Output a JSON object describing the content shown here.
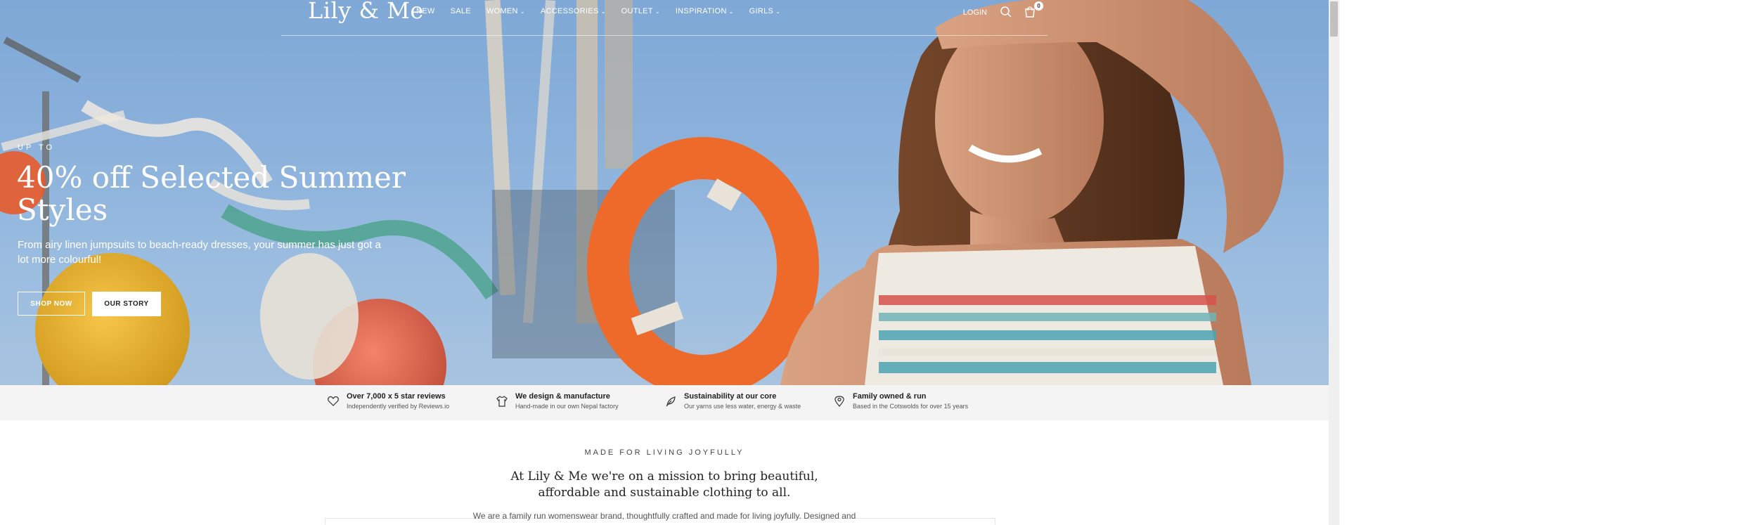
{
  "brand": {
    "logo": "Lily & Me"
  },
  "nav": {
    "items": [
      {
        "label": "NEW",
        "dropdown": false
      },
      {
        "label": "SALE",
        "dropdown": false
      },
      {
        "label": "WOMEN",
        "dropdown": true
      },
      {
        "label": "ACCESSORIES",
        "dropdown": true
      },
      {
        "label": "OUTLET",
        "dropdown": true
      },
      {
        "label": "INSPIRATION",
        "dropdown": true
      },
      {
        "label": "GIRLS",
        "dropdown": true
      }
    ],
    "login": "LOGIN",
    "cart_count": "0"
  },
  "hero": {
    "eyebrow": "UP TO",
    "title": "40% off Selected Summer Styles",
    "subtitle": "From airy linen jumpsuits to beach-ready dresses, your summer has just got a lot more colourful!",
    "shop_button": "SHOP NOW",
    "story_button": "OUR STORY"
  },
  "usps": [
    {
      "icon": "heart-icon",
      "title": "Over 7,000 x 5 star reviews",
      "subtitle": "Independently verified by Reviews.io"
    },
    {
      "icon": "tshirt-icon",
      "title": "We design & manufacture",
      "subtitle": "Hand-made in our own Nepal factory"
    },
    {
      "icon": "leaf-icon",
      "title": "Sustainability at our core",
      "subtitle": "Our yarns use less water, energy & waste"
    },
    {
      "icon": "location-pin-icon",
      "title": "Family owned & run",
      "subtitle": "Based in the Cotswolds for over 15 years"
    }
  ],
  "mission": {
    "eyebrow": "MADE FOR LIVING JOYFULLY",
    "title": "At Lily & Me we're on a mission to bring beautiful, affordable and sustainable clothing to all.",
    "text": "We are a family run womenswear brand, thoughtfully crafted and made for living joyfully. Designed and"
  },
  "colors": {
    "accent": "#ffffff",
    "usp_bg": "#f4f4f4",
    "text": "#222222"
  }
}
